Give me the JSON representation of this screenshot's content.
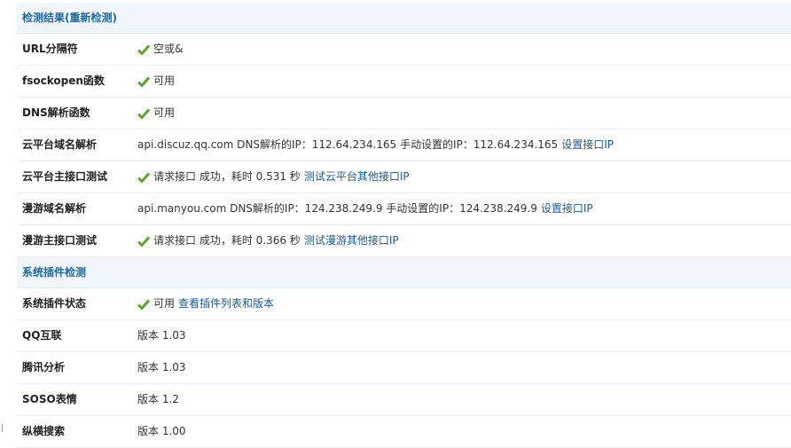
{
  "section1": {
    "title": "检测结果(重新检测)",
    "rows": [
      {
        "label": "URL分隔符",
        "value": "空或&"
      },
      {
        "label": "fsockopen函数",
        "value": "可用"
      },
      {
        "label": "DNS解析函数",
        "value": "可用"
      },
      {
        "label": "云平台域名解析",
        "value": "api.discuz.qq.com DNS解析的IP：112.64.234.165 手动设置的IP：112.64.234.165",
        "link": "设置接口IP"
      },
      {
        "label": "云平台主接口测试",
        "value": "请求接口 成功，耗时 0.531 秒",
        "link": "测试云平台其他接口IP"
      },
      {
        "label": "漫游域名解析",
        "value": "api.manyou.com DNS解析的IP：124.238.249.9 手动设置的IP：124.238.249.9",
        "link": "设置接口IP"
      },
      {
        "label": "漫游主接口测试",
        "value": "请求接口 成功，耗时 0.366 秒",
        "link": "测试漫游其他接口IP"
      }
    ]
  },
  "section2": {
    "title": "系统插件检测",
    "rows": [
      {
        "label": "系统插件状态",
        "value": "可用",
        "link": "查看插件列表和版本"
      },
      {
        "label": "QQ互联",
        "value": "版本 1.03"
      },
      {
        "label": "腾讯分析",
        "value": "版本 1.03"
      },
      {
        "label": "SOSO表情",
        "value": "版本 1.2"
      },
      {
        "label": "纵横搜索",
        "value": "版本 1.00"
      }
    ]
  },
  "colors": {
    "accent": "#1b6aa0",
    "link": "#1b5a96",
    "check": "#5aa52b",
    "header_bg": "#f0f6fb"
  },
  "icons": {
    "check": "check-icon"
  }
}
